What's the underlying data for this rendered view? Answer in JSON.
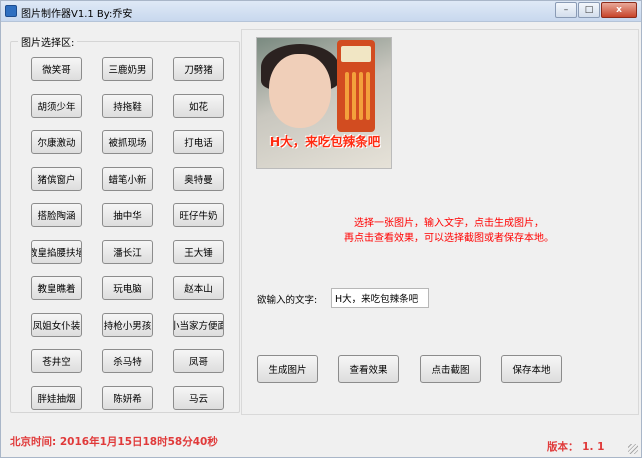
{
  "window": {
    "title": "图片制作器V1.1  By:乔安",
    "minimize_glyph": "–",
    "maximize_glyph": "□",
    "close_glyph": "x"
  },
  "picker": {
    "label": "图片选择区:",
    "buttons": [
      "微笑哥",
      "三鹿奶男",
      "刀劈猪",
      "胡须少年",
      "持拖鞋",
      "如花",
      "尔康激动",
      "被抓现场",
      "打电话",
      "猪傧窗户",
      "蜡笔小新",
      "奥特曼",
      "搭脸陶涵",
      "抽中华",
      "旺仔牛奶",
      "教皇掐腰扶墙",
      "潘长江",
      "王大锤",
      "教皇瞧着",
      "玩电脑",
      "赵本山",
      "凤姐女仆装",
      "持枪小男孩",
      "小当家方便面",
      "苍井空",
      "杀马特",
      "凤哥",
      "胖娃抽烟",
      "陈妍希",
      "马云"
    ]
  },
  "preview": {
    "caption": "H大，来吃包辣条吧"
  },
  "hint": {
    "line1": "选择一张图片，输入文字，点击生成图片，",
    "line2": "再点击查看效果，可以选择截图或者保存本地。"
  },
  "text_input": {
    "label": "欲输入的文字:",
    "value": "H大，来吃包辣条吧"
  },
  "actions": {
    "generate": "生成图片",
    "view": "查看效果",
    "screenshot": "点击截图",
    "save": "保存本地"
  },
  "status": {
    "time": "北京时间:  2016年1月15日18时58分40秒",
    "version": "版本：  1. 1"
  }
}
